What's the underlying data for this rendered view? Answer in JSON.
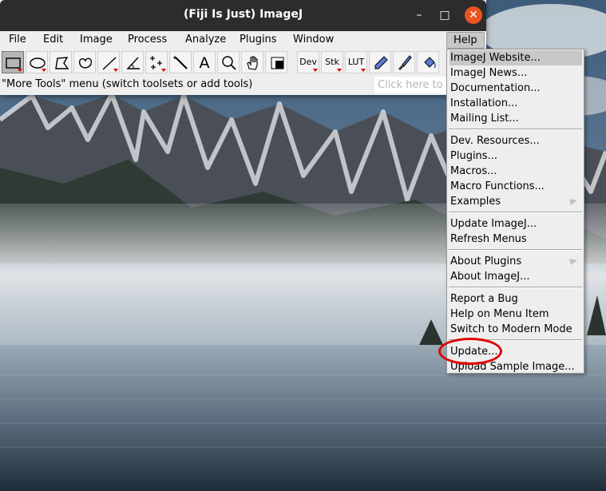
{
  "window": {
    "title": "(Fiji Is Just) ImageJ",
    "controls": {
      "minimize": "–",
      "maximize": "□",
      "close": "✕"
    }
  },
  "menubar": {
    "items": [
      "File",
      "Edit",
      "Image",
      "Process",
      "Analyze",
      "Plugins",
      "Window",
      "Help"
    ]
  },
  "toolbar": {
    "tools": [
      {
        "name": "rectangle-icon"
      },
      {
        "name": "oval-icon"
      },
      {
        "name": "polygon-icon"
      },
      {
        "name": "freehand-icon"
      },
      {
        "name": "line-icon"
      },
      {
        "name": "angle-icon"
      },
      {
        "name": "multipoint-icon"
      },
      {
        "name": "wand-icon"
      },
      {
        "name": "text-icon"
      },
      {
        "name": "magnifier-icon"
      },
      {
        "name": "hand-icon"
      },
      {
        "name": "color-picker-icon"
      }
    ],
    "labels": {
      "text_tool": "A",
      "dev": "Dev",
      "stk": "Stk",
      "lut": "LUT"
    }
  },
  "status": {
    "message": "\"More Tools\" menu (switch toolsets or add tools)",
    "search_placeholder": "Click here to s"
  },
  "help_menu": {
    "groups": [
      [
        "ImageJ Website...",
        "ImageJ News...",
        "Documentation...",
        "Installation...",
        "Mailing List..."
      ],
      [
        "Dev. Resources...",
        "Plugins...",
        "Macros...",
        "Macro Functions...",
        "Examples"
      ],
      [
        "Update ImageJ...",
        "Refresh Menus"
      ],
      [
        "About Plugins",
        "About ImageJ..."
      ],
      [
        "Report a Bug",
        "Help on Menu Item",
        "Switch to Modern Mode"
      ],
      [
        "Update...",
        "Upload Sample Image..."
      ]
    ],
    "highlighted": "ImageJ Website...",
    "circled": "Update..."
  },
  "colors": {
    "titlebar": "#2c2c2c",
    "close_button": "#e95420",
    "annotation": "#e00000"
  }
}
